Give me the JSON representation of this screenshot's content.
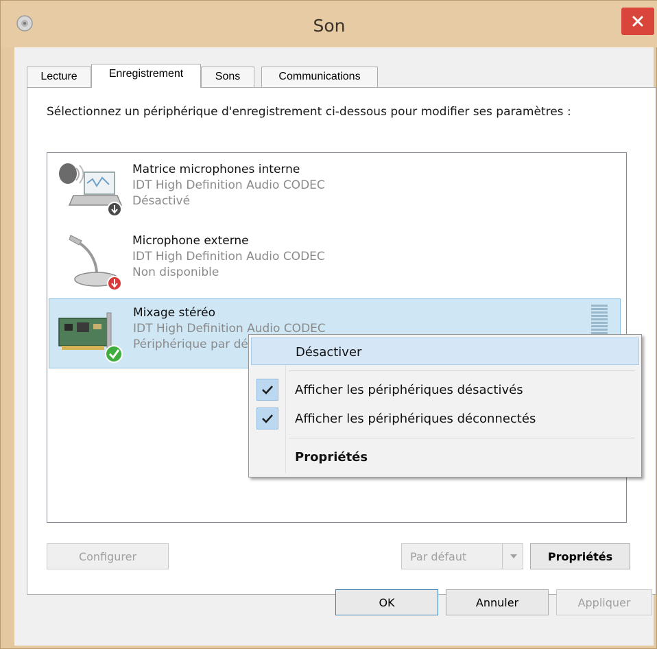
{
  "window": {
    "title": "Son",
    "close_icon": "close-icon",
    "app_icon": "speaker-icon"
  },
  "tabs": [
    {
      "label": "Lecture",
      "active": false
    },
    {
      "label": "Enregistrement",
      "active": true
    },
    {
      "label": "Sons",
      "active": false
    },
    {
      "label": "Communications",
      "active": false
    }
  ],
  "instruction": "Sélectionnez un périphérique d'enregistrement ci-dessous pour modifier ses paramètres :",
  "devices": [
    {
      "name": "Matrice microphones interne",
      "driver": "IDT High Definition Audio CODEC",
      "status": "Désactivé",
      "icon": "laptop-microphone-icon",
      "badge": "disabled-arrow-icon",
      "selected": false
    },
    {
      "name": "Microphone externe",
      "driver": "IDT High Definition Audio CODEC",
      "status": "Non disponible",
      "icon": "desk-microphone-icon",
      "badge": "unavailable-arrow-icon",
      "selected": false
    },
    {
      "name": "Mixage stéréo",
      "driver": "IDT High Definition Audio CODEC",
      "status": "Périphérique par défaut",
      "icon": "sound-card-icon",
      "badge": "default-check-icon",
      "selected": true
    }
  ],
  "buttons": {
    "configure": "Configurer",
    "set_default": "Par défaut",
    "properties": "Propriétés",
    "ok": "OK",
    "cancel": "Annuler",
    "apply": "Appliquer"
  },
  "context_menu": {
    "items": [
      {
        "label": "Désactiver",
        "checked": false,
        "bold": false,
        "hover": true
      },
      {
        "label": "Afficher les périphériques désactivés",
        "checked": true,
        "bold": false,
        "hover": false
      },
      {
        "label": "Afficher les périphériques déconnectés",
        "checked": true,
        "bold": false,
        "hover": false
      },
      {
        "label": "Propriétés",
        "checked": false,
        "bold": true,
        "hover": false
      }
    ]
  },
  "colors": {
    "titlebar": "#e6cba4",
    "close": "#d9453a",
    "selection": "#cfe6f5",
    "menu_hover": "#d5e7f7",
    "default_badge": "#3fae3f",
    "unavailable_badge": "#d93a3a"
  }
}
